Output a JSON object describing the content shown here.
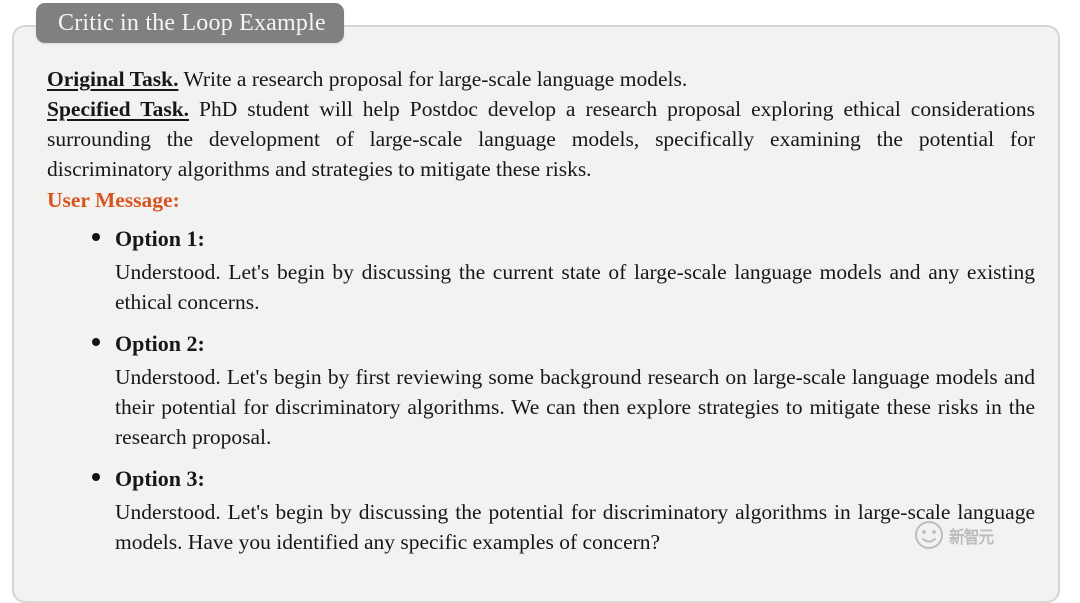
{
  "figure": {
    "title_badge": "Critic in the Loop Example",
    "accent_color": "#d9541f",
    "badge_color": "#808080",
    "box_background": "#f2f2f0",
    "box_border_color": "#d6d6d4"
  },
  "tasks": {
    "original_label": "Original Task.",
    "original_text": " Write a research proposal for large-scale language models.",
    "specified_label": "Specified Task.",
    "specified_text": " PhD student will help Postdoc develop a research proposal exploring ethical considerations surrounding the development of large-scale language models, specifically examining the potential for discriminatory algorithms and strategies to mitigate these risks.",
    "user_message_label": "User Message:"
  },
  "options": [
    {
      "title": "Option 1:",
      "body": "Understood.  Let's begin by discussing the current state of large-scale language models and any existing ethical concerns."
    },
    {
      "title": "Option 2:",
      "body": "Understood. Let's begin by first reviewing some background research on large-scale language models and their potential for discriminatory algorithms.  We can then explore strategies to mitigate these risks in the research proposal."
    },
    {
      "title": "Option 3:",
      "body": "Understood. Let's begin by discussing the potential for discriminatory algorithms in large-scale language models. Have you identified any specific examples of concern?"
    }
  ],
  "watermark": {
    "text": "新智元",
    "logo": "mascot-face-icon"
  }
}
